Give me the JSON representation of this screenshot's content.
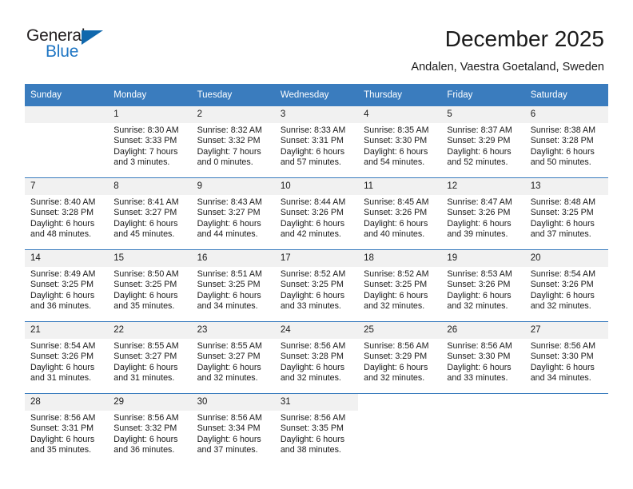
{
  "logo": {
    "word1": "General",
    "word2": "Blue",
    "triangle_color": "#1068ad",
    "blue_color": "#1f76c4"
  },
  "header": {
    "title": "December 2025",
    "subtitle": "Andalen, Vaestra Goetaland, Sweden"
  },
  "theme": {
    "header_blue": "#3a7cbe",
    "daynum_bg": "#f1f1f1"
  },
  "calendar": {
    "weekday_headers": [
      "Sunday",
      "Monday",
      "Tuesday",
      "Wednesday",
      "Thursday",
      "Friday",
      "Saturday"
    ],
    "weeks": [
      [
        {
          "day": "",
          "lines": []
        },
        {
          "day": "1",
          "lines": [
            "Sunrise: 8:30 AM",
            "Sunset: 3:33 PM",
            "Daylight: 7 hours",
            "and 3 minutes."
          ]
        },
        {
          "day": "2",
          "lines": [
            "Sunrise: 8:32 AM",
            "Sunset: 3:32 PM",
            "Daylight: 7 hours",
            "and 0 minutes."
          ]
        },
        {
          "day": "3",
          "lines": [
            "Sunrise: 8:33 AM",
            "Sunset: 3:31 PM",
            "Daylight: 6 hours",
            "and 57 minutes."
          ]
        },
        {
          "day": "4",
          "lines": [
            "Sunrise: 8:35 AM",
            "Sunset: 3:30 PM",
            "Daylight: 6 hours",
            "and 54 minutes."
          ]
        },
        {
          "day": "5",
          "lines": [
            "Sunrise: 8:37 AM",
            "Sunset: 3:29 PM",
            "Daylight: 6 hours",
            "and 52 minutes."
          ]
        },
        {
          "day": "6",
          "lines": [
            "Sunrise: 8:38 AM",
            "Sunset: 3:28 PM",
            "Daylight: 6 hours",
            "and 50 minutes."
          ]
        }
      ],
      [
        {
          "day": "7",
          "lines": [
            "Sunrise: 8:40 AM",
            "Sunset: 3:28 PM",
            "Daylight: 6 hours",
            "and 48 minutes."
          ]
        },
        {
          "day": "8",
          "lines": [
            "Sunrise: 8:41 AM",
            "Sunset: 3:27 PM",
            "Daylight: 6 hours",
            "and 45 minutes."
          ]
        },
        {
          "day": "9",
          "lines": [
            "Sunrise: 8:43 AM",
            "Sunset: 3:27 PM",
            "Daylight: 6 hours",
            "and 44 minutes."
          ]
        },
        {
          "day": "10",
          "lines": [
            "Sunrise: 8:44 AM",
            "Sunset: 3:26 PM",
            "Daylight: 6 hours",
            "and 42 minutes."
          ]
        },
        {
          "day": "11",
          "lines": [
            "Sunrise: 8:45 AM",
            "Sunset: 3:26 PM",
            "Daylight: 6 hours",
            "and 40 minutes."
          ]
        },
        {
          "day": "12",
          "lines": [
            "Sunrise: 8:47 AM",
            "Sunset: 3:26 PM",
            "Daylight: 6 hours",
            "and 39 minutes."
          ]
        },
        {
          "day": "13",
          "lines": [
            "Sunrise: 8:48 AM",
            "Sunset: 3:25 PM",
            "Daylight: 6 hours",
            "and 37 minutes."
          ]
        }
      ],
      [
        {
          "day": "14",
          "lines": [
            "Sunrise: 8:49 AM",
            "Sunset: 3:25 PM",
            "Daylight: 6 hours",
            "and 36 minutes."
          ]
        },
        {
          "day": "15",
          "lines": [
            "Sunrise: 8:50 AM",
            "Sunset: 3:25 PM",
            "Daylight: 6 hours",
            "and 35 minutes."
          ]
        },
        {
          "day": "16",
          "lines": [
            "Sunrise: 8:51 AM",
            "Sunset: 3:25 PM",
            "Daylight: 6 hours",
            "and 34 minutes."
          ]
        },
        {
          "day": "17",
          "lines": [
            "Sunrise: 8:52 AM",
            "Sunset: 3:25 PM",
            "Daylight: 6 hours",
            "and 33 minutes."
          ]
        },
        {
          "day": "18",
          "lines": [
            "Sunrise: 8:52 AM",
            "Sunset: 3:25 PM",
            "Daylight: 6 hours",
            "and 32 minutes."
          ]
        },
        {
          "day": "19",
          "lines": [
            "Sunrise: 8:53 AM",
            "Sunset: 3:26 PM",
            "Daylight: 6 hours",
            "and 32 minutes."
          ]
        },
        {
          "day": "20",
          "lines": [
            "Sunrise: 8:54 AM",
            "Sunset: 3:26 PM",
            "Daylight: 6 hours",
            "and 32 minutes."
          ]
        }
      ],
      [
        {
          "day": "21",
          "lines": [
            "Sunrise: 8:54 AM",
            "Sunset: 3:26 PM",
            "Daylight: 6 hours",
            "and 31 minutes."
          ]
        },
        {
          "day": "22",
          "lines": [
            "Sunrise: 8:55 AM",
            "Sunset: 3:27 PM",
            "Daylight: 6 hours",
            "and 31 minutes."
          ]
        },
        {
          "day": "23",
          "lines": [
            "Sunrise: 8:55 AM",
            "Sunset: 3:27 PM",
            "Daylight: 6 hours",
            "and 32 minutes."
          ]
        },
        {
          "day": "24",
          "lines": [
            "Sunrise: 8:56 AM",
            "Sunset: 3:28 PM",
            "Daylight: 6 hours",
            "and 32 minutes."
          ]
        },
        {
          "day": "25",
          "lines": [
            "Sunrise: 8:56 AM",
            "Sunset: 3:29 PM",
            "Daylight: 6 hours",
            "and 32 minutes."
          ]
        },
        {
          "day": "26",
          "lines": [
            "Sunrise: 8:56 AM",
            "Sunset: 3:30 PM",
            "Daylight: 6 hours",
            "and 33 minutes."
          ]
        },
        {
          "day": "27",
          "lines": [
            "Sunrise: 8:56 AM",
            "Sunset: 3:30 PM",
            "Daylight: 6 hours",
            "and 34 minutes."
          ]
        }
      ],
      [
        {
          "day": "28",
          "lines": [
            "Sunrise: 8:56 AM",
            "Sunset: 3:31 PM",
            "Daylight: 6 hours",
            "and 35 minutes."
          ]
        },
        {
          "day": "29",
          "lines": [
            "Sunrise: 8:56 AM",
            "Sunset: 3:32 PM",
            "Daylight: 6 hours",
            "and 36 minutes."
          ]
        },
        {
          "day": "30",
          "lines": [
            "Sunrise: 8:56 AM",
            "Sunset: 3:34 PM",
            "Daylight: 6 hours",
            "and 37 minutes."
          ]
        },
        {
          "day": "31",
          "lines": [
            "Sunrise: 8:56 AM",
            "Sunset: 3:35 PM",
            "Daylight: 6 hours",
            "and 38 minutes."
          ]
        },
        {
          "day": "",
          "lines": []
        },
        {
          "day": "",
          "lines": []
        },
        {
          "day": "",
          "lines": []
        }
      ]
    ]
  }
}
